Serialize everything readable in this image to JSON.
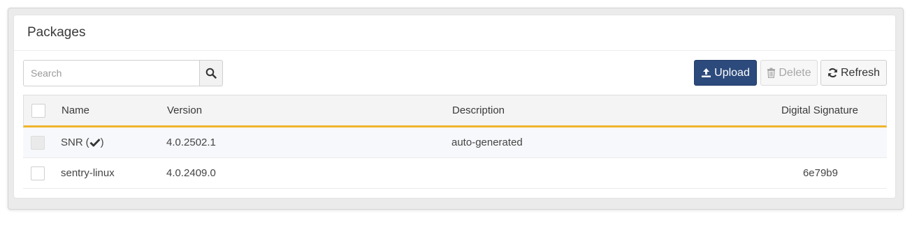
{
  "panel": {
    "title": "Packages"
  },
  "search": {
    "placeholder": "Search"
  },
  "toolbar": {
    "upload_label": "Upload",
    "delete_label": "Delete",
    "refresh_label": "Refresh"
  },
  "table": {
    "columns": [
      "Name",
      "Version",
      "Description",
      "Digital Signature"
    ],
    "rows": [
      {
        "name": "SNR",
        "name_suffix_open": "(",
        "name_suffix_close": ")",
        "verified": true,
        "version": "4.0.2502.1",
        "description": "auto-generated",
        "signature": "",
        "checkbox_disabled": true
      },
      {
        "name": "sentry-linux",
        "version": "4.0.2409.0",
        "description": "",
        "signature": "6e79b9",
        "checkbox_disabled": false
      }
    ]
  },
  "colors": {
    "primary": "#2c4a7c",
    "header_underline": "#f0b429"
  },
  "icons": {
    "search": "search-icon",
    "upload": "upload-icon",
    "delete": "trash-icon",
    "refresh": "refresh-icon",
    "verified": "check-icon"
  }
}
